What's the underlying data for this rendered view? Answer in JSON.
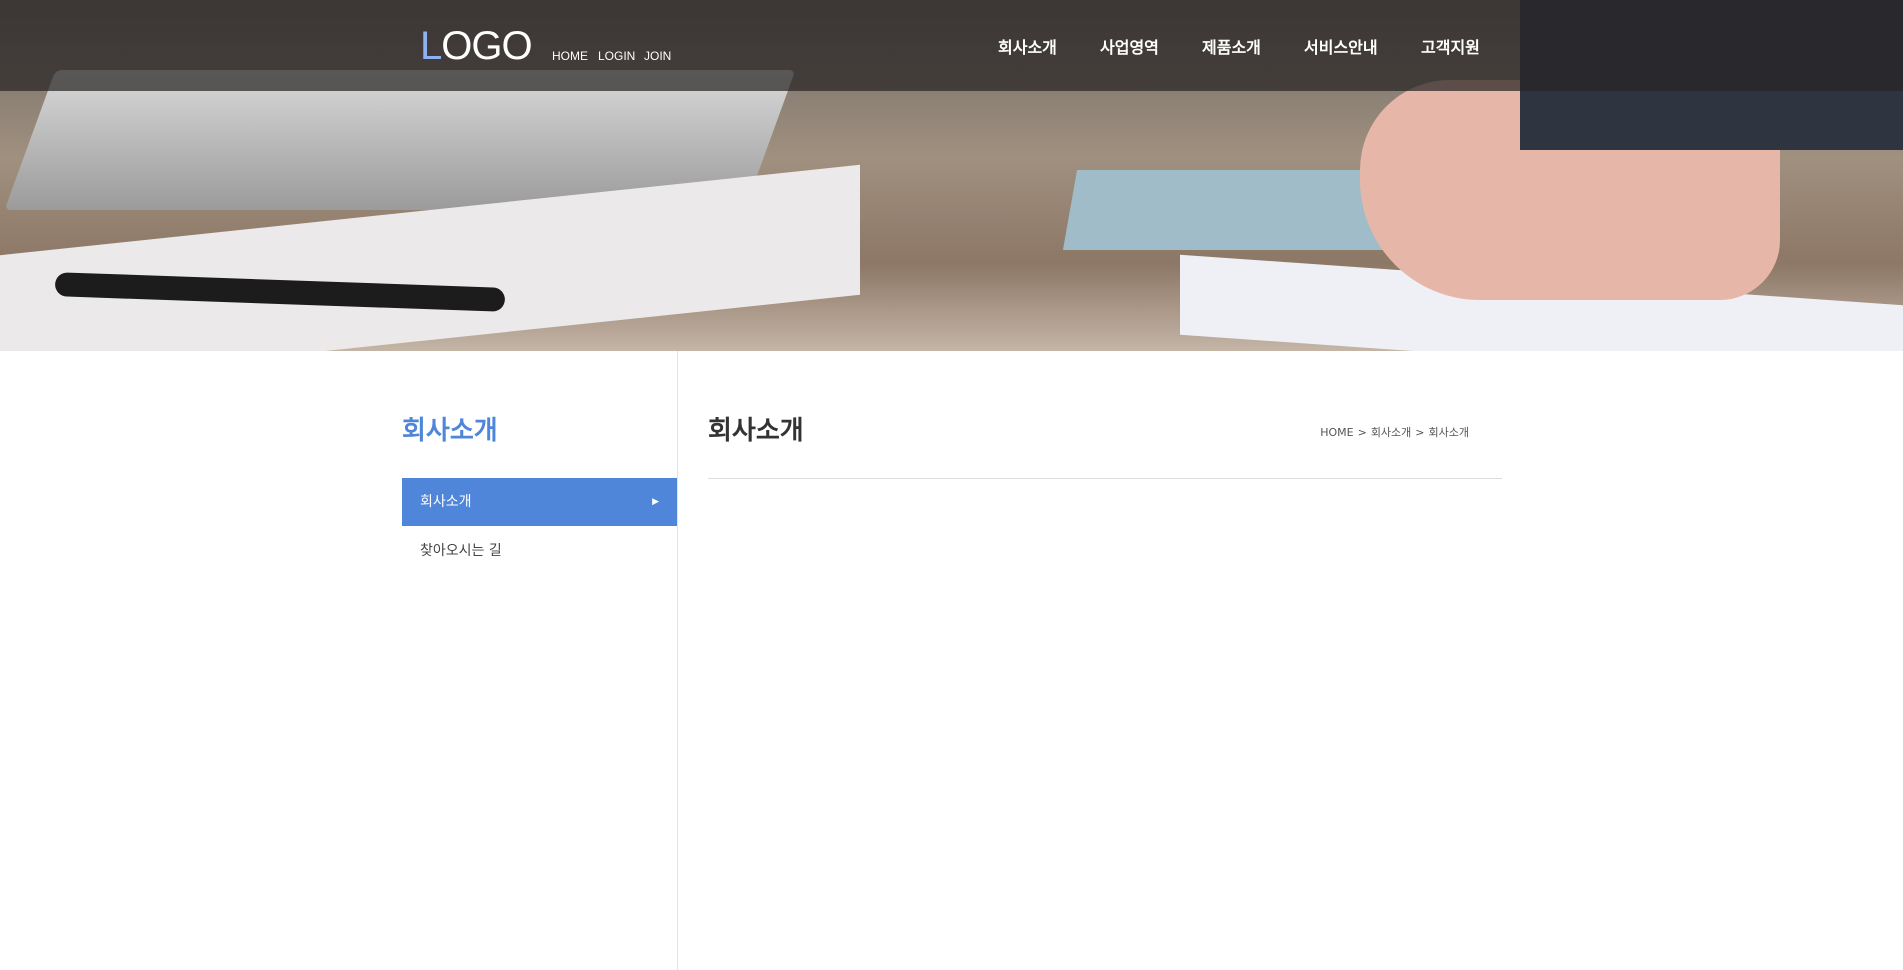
{
  "header": {
    "logo": {
      "first": "L",
      "rest": "OGO"
    },
    "util_links": [
      "HOME",
      "LOGIN",
      "JOIN"
    ],
    "nav": [
      "회사소개",
      "사업영역",
      "제품소개",
      "서비스안내",
      "고객지원"
    ]
  },
  "sidebar": {
    "title": "회사소개",
    "items": [
      {
        "label": "회사소개",
        "active": true
      },
      {
        "label": "찾아오시는 길",
        "active": false
      }
    ]
  },
  "content": {
    "title": "회사소개",
    "breadcrumb": [
      "HOME",
      "회사소개",
      "회사소개"
    ],
    "separator": ">"
  },
  "colors": {
    "accent": "#4f86d9"
  }
}
